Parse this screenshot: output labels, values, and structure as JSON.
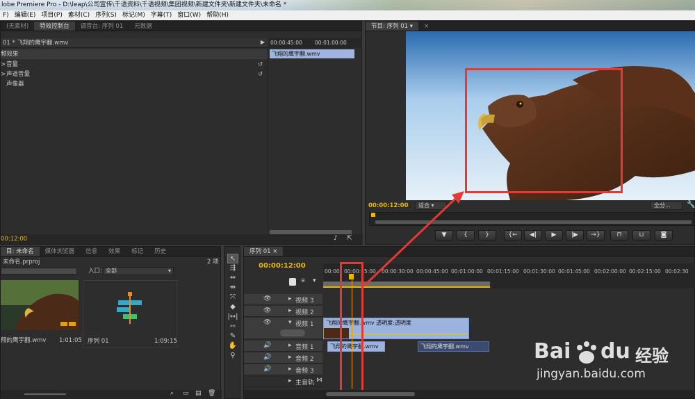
{
  "window": {
    "title": "lobe Premiere Pro - D:\\leap\\公司宣传\\千语资料\\千语视频\\集团视频\\新建文件夹\\新建文件夹\\未命名 *"
  },
  "menu": [
    "F)",
    "编辑(E)",
    "项目(P)",
    "素材(C)",
    "序列(S)",
    "标记(M)",
    "字幕(T)",
    "窗口(W)",
    "帮助(H)"
  ],
  "source_panel": {
    "tabs": [
      "(无素材)",
      "特效控制台",
      "调音台: 序列 01",
      "元数据"
    ],
    "active_tab": 1,
    "clip_header": "01 * 飞翔的鹰宇翻.wmv",
    "ruler": [
      "00:00:45:00",
      "00:01:00:00"
    ],
    "clip_label": "飞翔的鹰宇翻.wmv",
    "effects_heading": "频效果",
    "effects": [
      "音量",
      "声道音量",
      "声像器"
    ],
    "timecode": "00:12:00"
  },
  "program_monitor": {
    "tab": "节目: 序列 01",
    "timecode": "00:00:12:00",
    "fit": "适合",
    "quality": "全分..."
  },
  "project_panel": {
    "tabs": [
      "目: 未命名",
      "媒体浏览器",
      "信息",
      "效果",
      "标记",
      "历史"
    ],
    "project_name": "未命名.prproj",
    "item_count": "2 项",
    "in_label": "入口:",
    "in_value": "全部",
    "items": [
      {
        "name": "翔的鹰宇翻.wmv",
        "duration": "1:01:05"
      },
      {
        "name": "序列 01",
        "duration": "1:09:15"
      }
    ]
  },
  "timeline": {
    "tab": "序列 01",
    "timecode": "00:00:12:00",
    "ruler": [
      "00:00",
      "00:00:15:00",
      "00:00:30:00",
      "00:00:45:00",
      "00:01:00:00",
      "00:01:15:00",
      "00:01:30:00",
      "00:01:45:00",
      "00:02:00:00",
      "00:02:15:00",
      "00:02:30"
    ],
    "tracks": [
      "视频 3",
      "视频 2",
      "视频 1",
      "音频 1",
      "音频 2",
      "音频 3",
      "主音轨"
    ],
    "video_clip": "飞翔的鹰宇翻.wmv  透明度:透明度",
    "audio_clip_a": "飞翔的鹰宇翻.wmv",
    "audio_clip_b": "飞翔的鹰宇翻.wmv"
  },
  "watermark": {
    "brand": "Bai",
    "brand2": "du",
    "cn": "经验",
    "url": "jingyan.baidu.com"
  }
}
